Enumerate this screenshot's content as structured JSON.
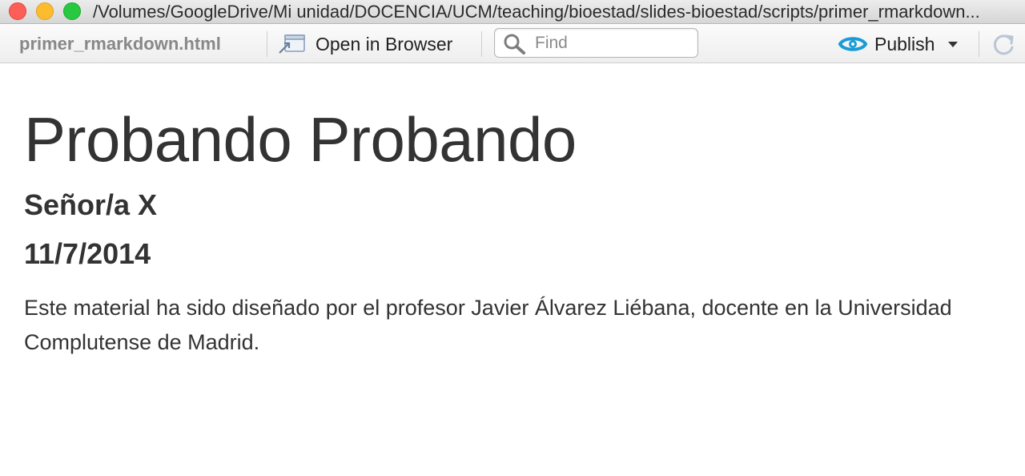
{
  "window": {
    "title": "/Volumes/GoogleDrive/Mi unidad/DOCENCIA/UCM/teaching/bioestad/slides-bioestad/scripts/primer_rmarkdown..."
  },
  "toolbar": {
    "file_name": "primer_rmarkdown.html",
    "open_in_browser_label": "Open in Browser",
    "find_placeholder": "Find",
    "find_value": "",
    "publish_label": "Publish",
    "publish_color": "#1a9bd7"
  },
  "document": {
    "title": "Probando Probando",
    "author": "Señor/a X",
    "date": "11/7/2014",
    "body": "Este material ha sido diseñado por el profesor Javier Álvarez Liébana, docente en la Universidad Complutense de Madrid."
  }
}
